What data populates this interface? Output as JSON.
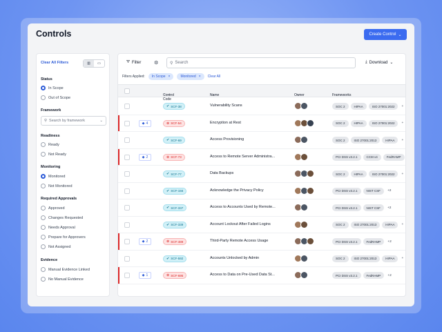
{
  "page": {
    "title": "Controls",
    "create_button": "Create Control"
  },
  "filters": {
    "clear_all": "Clear All Filters",
    "status": {
      "title": "Status",
      "options": [
        "In Scope",
        "Out of Scope"
      ],
      "selected": 0
    },
    "framework": {
      "title": "Framework",
      "placeholder": "Search by framework"
    },
    "readiness": {
      "title": "Readiness",
      "options": [
        "Ready",
        "Not Ready"
      ]
    },
    "monitoring": {
      "title": "Monitoring",
      "options": [
        "Monitored",
        "Not Monitored"
      ],
      "selected": 0
    },
    "approvals": {
      "title": "Required Approvals",
      "options": [
        "Approved",
        "Changes Requested",
        "Needs Approval",
        "Prepare for Approvers",
        "Not Assigned"
      ]
    },
    "evidence": {
      "title": "Evidence",
      "options": [
        "Manual Evidence Linked",
        "No Manual Evidence"
      ]
    }
  },
  "toolbar": {
    "filter_label": "Filter",
    "search_placeholder": "Search",
    "download_label": "Download",
    "applied_label": "Filters Applied:",
    "chips": [
      "In Scope",
      "Monitored"
    ],
    "clear_label": "Clear All"
  },
  "table": {
    "columns": {
      "code": "Control Code",
      "name": "Name",
      "owner": "Owner",
      "frameworks": "Frameworks"
    },
    "rows": [
      {
        "count": "",
        "code": "SCF-38",
        "status": "ok",
        "name": "Vulnerability Scans",
        "owners": [
          "#8b6b5a",
          "#4b5563"
        ],
        "frameworks": [
          "SOC 2",
          "HIPAA",
          "ISO 27001:2022",
          "+"
        ],
        "flag": false
      },
      {
        "count": "4",
        "code": "SCF-54",
        "status": "bad",
        "name": "Encryption at Rest",
        "owners": [
          "#a0785a",
          "#6b4f3a",
          "#374151"
        ],
        "frameworks": [
          "SOC 2",
          "HIPAA",
          "ISO 27001:2022",
          "+"
        ],
        "flag": true
      },
      {
        "count": "",
        "code": "SCF-69",
        "status": "ok",
        "name": "Access Provisioning",
        "owners": [
          "#8b6b5a",
          "#4b5563"
        ],
        "frameworks": [
          "SOC 2",
          "ISO 27001:2013",
          "HIPAA",
          "+"
        ],
        "flag": false
      },
      {
        "count": "2",
        "code": "SCF-73",
        "status": "bad",
        "name": "Access to Remote Server Administra...",
        "owners": [
          "#a0785a",
          "#6b4f3a"
        ],
        "frameworks": [
          "PCI DSS v3.2.1",
          "CCM v4",
          "FedRAMP",
          "+"
        ],
        "flag": true
      },
      {
        "count": "",
        "code": "SCF-77",
        "status": "ok",
        "name": "Data Backups",
        "owners": [
          "#8b6b5a",
          "#4b5563",
          "#6b4f3a"
        ],
        "frameworks": [
          "SOC 2",
          "HIPAA",
          "ISO 27001:2022",
          "+"
        ],
        "flag": false
      },
      {
        "count": "",
        "code": "SCF-156",
        "status": "ok",
        "name": "Acknowledge the Privacy Policy",
        "owners": [
          "#a0785a",
          "#4b5563",
          "#6b4f3a"
        ],
        "frameworks": [
          "PCI DSS v3.2.1",
          "NIST CSF",
          "+2"
        ],
        "flag": false
      },
      {
        "count": "",
        "code": "SCF-337",
        "status": "ok",
        "name": "Access to Accounts Used by Remote...",
        "owners": [
          "#8b6b5a",
          "#4b5563"
        ],
        "frameworks": [
          "PCI DSS v3.2.1",
          "NIST CSF",
          "+2"
        ],
        "flag": false
      },
      {
        "count": "",
        "code": "SCF-339",
        "status": "ok",
        "name": "Account Lockout After Failed Logins",
        "owners": [
          "#a0785a",
          "#6b4f3a"
        ],
        "frameworks": [
          "SOC 2",
          "ISO 27001:2013",
          "HIPAA",
          "+"
        ],
        "flag": false
      },
      {
        "count": "2",
        "code": "SCF-489",
        "status": "bad",
        "name": "Third-Party Remote Access Usage",
        "owners": [
          "#8b6b5a",
          "#4b5563",
          "#6b4f3a"
        ],
        "frameworks": [
          "PCI DSS v3.2.1",
          "FedRAMP",
          "+2"
        ],
        "flag": true
      },
      {
        "count": "",
        "code": "SCF-592",
        "status": "ok",
        "name": "Accounts Unlocked by Admin",
        "owners": [
          "#a0785a",
          "#4b5563"
        ],
        "frameworks": [
          "SOC 2",
          "ISO 27001:2013",
          "HIPAA",
          "+"
        ],
        "flag": false
      },
      {
        "count": "1",
        "code": "SCF-695",
        "status": "bad",
        "name": "Access to Data on Pre-Used Data St...",
        "owners": [
          "#8b6b5a",
          "#4b5563"
        ],
        "frameworks": [
          "PCI DSS v3.2.1",
          "FedRAMP",
          "+2"
        ],
        "flag": true
      }
    ]
  }
}
